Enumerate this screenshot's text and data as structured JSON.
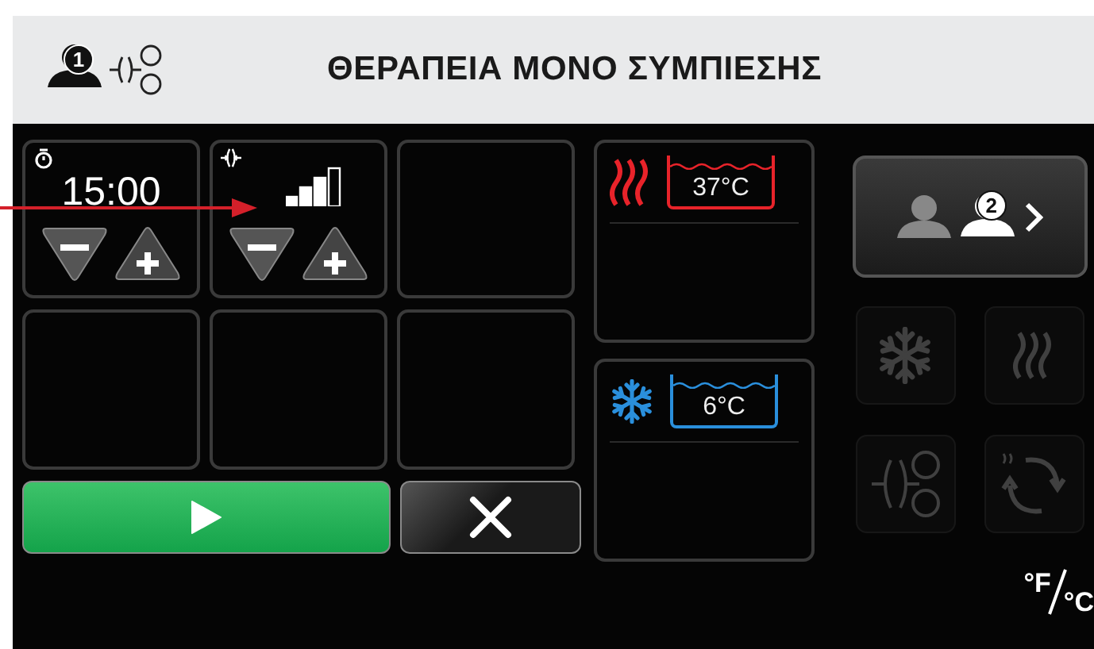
{
  "header": {
    "profile_number": "1",
    "title": "ΘΕΡΑΠΕΙΑ ΜΟΝΟ ΣΥΜΠΙΕΣΗΣ"
  },
  "controls": [
    {
      "kind": "timer",
      "value": "15:00"
    },
    {
      "kind": "intensity",
      "level": 0.75
    }
  ],
  "actions": [
    {
      "kind": "start"
    },
    {
      "kind": "cancel"
    }
  ],
  "baths": [
    {
      "kind": "heat",
      "temperature": "37°C",
      "color": "#e8232a"
    },
    {
      "kind": "cold",
      "temperature": "6°C",
      "color": "#2a8fdc"
    }
  ],
  "next_user": {
    "number": "2"
  },
  "modes": [
    {
      "kind": "cold",
      "disabled": true
    },
    {
      "kind": "heat",
      "disabled": true
    },
    {
      "kind": "compression",
      "disabled": true
    },
    {
      "kind": "cycle",
      "disabled": true
    }
  ],
  "units": {
    "fahrenheit": "°F",
    "celsius": "°C"
  },
  "annotation": {
    "arrow": true
  }
}
